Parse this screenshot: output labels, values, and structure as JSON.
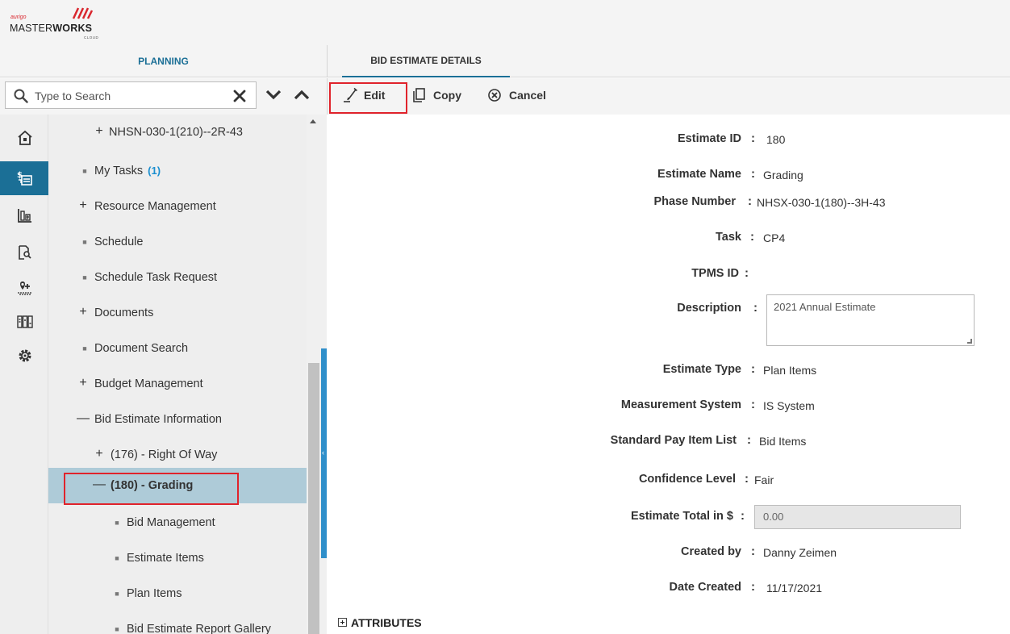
{
  "header": {
    "logo_small": "aurigo",
    "logo_main_light": "MASTER",
    "logo_main_bold": "WORKS",
    "logo_sub": "CLOUD"
  },
  "left_panel": {
    "tab_label": "PLANNING",
    "search": {
      "placeholder": "Type to Search",
      "value": ""
    },
    "rail_icons": [
      "home-icon",
      "bid-estimate-icon",
      "building-chart-icon",
      "document-search-icon",
      "location-map-icon",
      "modules-grid-icon",
      "settings-gear-icon"
    ],
    "tree": [
      {
        "label": "NHSN-030-1(210)--2R-43",
        "symbol": "+",
        "level": 2
      },
      {
        "label": "My Tasks",
        "symbol": "■",
        "level": 1,
        "badge": "(1)"
      },
      {
        "label": "Resource Management",
        "symbol": "+",
        "level": 1
      },
      {
        "label": "Schedule",
        "symbol": "■",
        "level": 1
      },
      {
        "label": "Schedule Task Request",
        "symbol": "■",
        "level": 1
      },
      {
        "label": "Documents",
        "symbol": "+",
        "level": 1
      },
      {
        "label": "Document Search",
        "symbol": "■",
        "level": 1
      },
      {
        "label": "Budget Management",
        "symbol": "+",
        "level": 1
      },
      {
        "label": "Bid Estimate Information",
        "symbol": "—",
        "level": 1
      },
      {
        "label": "(176) - Right Of Way",
        "symbol": "+",
        "level": 2
      },
      {
        "label": "(180) - Grading",
        "symbol": "—",
        "level": 3,
        "selected": true
      },
      {
        "label": "Bid Management",
        "symbol": "■",
        "level": 4
      },
      {
        "label": "Estimate Items",
        "symbol": "■",
        "level": 4
      },
      {
        "label": "Plan Items",
        "symbol": "■",
        "level": 4
      },
      {
        "label": "Bid Estimate Report Gallery",
        "symbol": "■",
        "level": 4
      }
    ]
  },
  "right_panel": {
    "tab_label": "BID ESTIMATE DETAILS",
    "toolbar": {
      "edit": "Edit",
      "copy": "Copy",
      "cancel": "Cancel"
    },
    "fields": {
      "estimate_id": {
        "label": "Estimate ID",
        "value": "180"
      },
      "estimate_name": {
        "label": "Estimate Name",
        "value": "Grading"
      },
      "phase_number": {
        "label": "Phase Number",
        "value": "NHSX-030-1(180)--3H-43"
      },
      "task": {
        "label": "Task",
        "value": "CP4"
      },
      "tpms_id": {
        "label": "TPMS ID",
        "value": ""
      },
      "description": {
        "label": "Description",
        "value": "2021 Annual Estimate"
      },
      "estimate_type": {
        "label": "Estimate Type",
        "value": "Plan Items"
      },
      "measurement_system": {
        "label": "Measurement System",
        "value": "IS System"
      },
      "standard_pay_item_list": {
        "label": "Standard Pay Item List",
        "value": "Bid Items"
      },
      "confidence_level": {
        "label": "Confidence Level",
        "value": "Fair"
      },
      "estimate_total": {
        "label": "Estimate Total in $",
        "value": "0.00"
      },
      "created_by": {
        "label": "Created by",
        "value": "Danny Zeimen"
      },
      "date_created": {
        "label": "Date Created",
        "value": "11/17/2021"
      }
    },
    "separator": ":",
    "attributes_label": "ATTRIBUTES"
  },
  "colors": {
    "accent": "#1b6f96",
    "highlight_border": "#e0232b",
    "selected_row": "#aecbd8",
    "badge": "#1b8fd0"
  }
}
